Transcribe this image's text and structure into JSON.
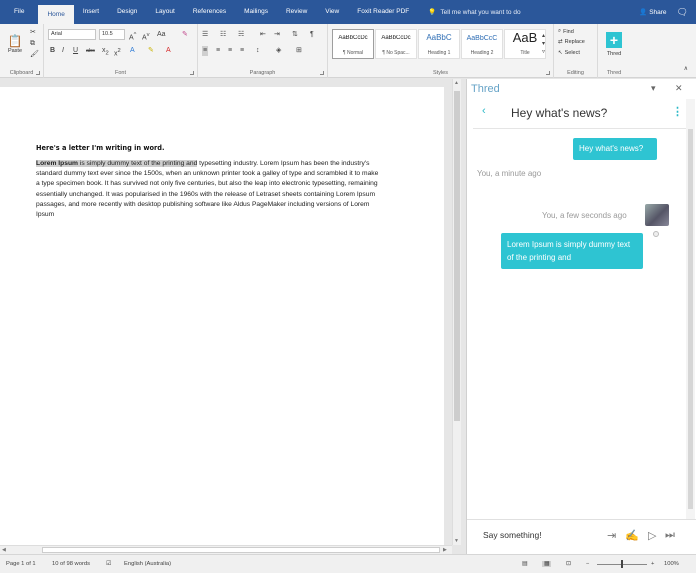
{
  "tabs": [
    "File",
    "Home",
    "Insert",
    "Design",
    "Layout",
    "References",
    "Mailings",
    "Review",
    "View",
    "Foxit Reader PDF"
  ],
  "active_tab": "Home",
  "tell_me": "Tell me what you want to do",
  "share_label": "Share",
  "clipboard": {
    "paste": "Paste",
    "label": "Clipboard"
  },
  "font": {
    "name": "Arial",
    "size": "10.5",
    "label": "Font",
    "case_btn": "Aa"
  },
  "paragraph": {
    "label": "Paragraph"
  },
  "styles": {
    "label": "Styles",
    "items": [
      {
        "preview": "AaBbCcDc",
        "name": "¶ Normal"
      },
      {
        "preview": "AaBbCcDc",
        "name": "¶ No Spac..."
      },
      {
        "preview": "AaBbC",
        "name": "Heading 1"
      },
      {
        "preview": "AaBbCcC",
        "name": "Heading 2"
      },
      {
        "preview": "AaB",
        "name": "Title"
      }
    ]
  },
  "editing": {
    "find": "Find",
    "replace": "Replace",
    "select": "Select",
    "label": "Editing"
  },
  "thred_group": {
    "button": "Thred",
    "label": "Thred"
  },
  "document": {
    "heading": "Here's a letter I'm writing in word.",
    "bold_text": "Lorem Ipsum",
    "highlight_rest": " is simply dummy text of the printing and",
    "body_rest": " typesetting industry. Lorem Ipsum has been the industry's standard dummy text ever since the 1500s, when an unknown printer took a galley of type and scrambled it to make a type specimen book. It has survived not only five centuries, but also the leap into electronic typesetting, remaining essentially unchanged. It was popularised in the 1960s with the release of Letraset sheets containing Lorem Ipsum passages, and more recently with desktop publishing software like Aldus PageMaker including versions of Lorem Ipsum"
  },
  "pane": {
    "title": "Thred",
    "chat_title": "Hey what's news?",
    "messages": [
      {
        "text": "Hey what's news?",
        "meta": "You, a minute ago"
      },
      {
        "meta": "You, a few seconds ago",
        "text": "Lorem Ipsum is simply dummy text of the printing and"
      }
    ],
    "compose_placeholder": "Say something!"
  },
  "status": {
    "page": "Page 1 of 1",
    "words": "10 of 98 words",
    "language": "English (Australia)",
    "zoom": "100%"
  },
  "colors": {
    "ribbon_blue": "#2b579a",
    "thred_teal": "#2ec4d2",
    "pane_title": "#66a3c7"
  }
}
